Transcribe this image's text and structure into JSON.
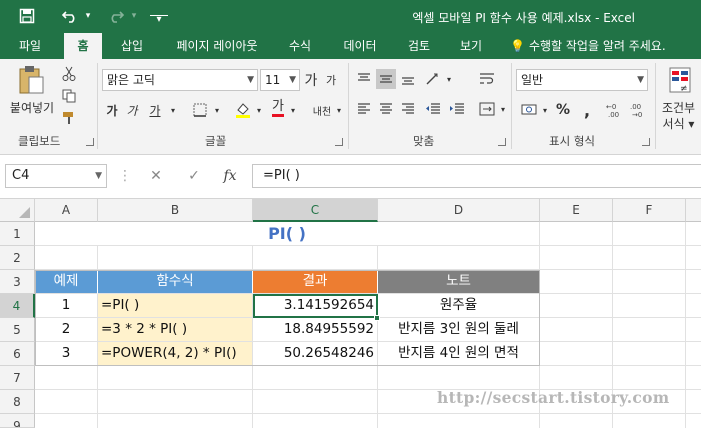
{
  "window": {
    "title": "엑셀 모바일 PI 함수 사용 예제.xlsx - Excel"
  },
  "quick_access": {
    "icons": [
      "save-icon",
      "undo-icon",
      "redo-icon",
      "customize-icon"
    ],
    "undo_dd": "▾",
    "redo_dd": "▾",
    "customize": "▾"
  },
  "tabs": [
    "파일",
    "홈",
    "삽입",
    "페이지 레이아웃",
    "수식",
    "데이터",
    "검토",
    "보기"
  ],
  "active_tab": "홈",
  "tell_me": "수행할 작업을 알려 주세요.",
  "ribbon": {
    "clipboard": {
      "paste_label": "붙여넣기",
      "group_label": "클립보드"
    },
    "font": {
      "name": "맑은 고딕",
      "size": "11",
      "grow_label": "가",
      "shrink_label": "가",
      "bold": "가",
      "italic": "가",
      "underline": "가",
      "font_color_label": "가",
      "phonetic_label": "내천",
      "group_label": "글꼴"
    },
    "alignment": {
      "group_label": "맞춤"
    },
    "number": {
      "format": "일반",
      "percent": "%",
      "comma": ",",
      "group_label": "표시 형식"
    },
    "styles": {
      "label_line1": "조건부",
      "label_line2": "서식 ▾"
    }
  },
  "formula_bar": {
    "name_box": "C4",
    "cancel": "✕",
    "enter": "✓",
    "fx": "fx",
    "formula": "=PI( )"
  },
  "colors": {
    "brand": "#217346",
    "header_blue": "#5b9bd5",
    "header_orange": "#ed7d31",
    "header_gray": "#808080",
    "input_yellow": "#fff2cc",
    "title_blue": "#4472c4"
  },
  "grid": {
    "columns": [
      "A",
      "B",
      "C",
      "D",
      "E",
      "F"
    ],
    "rows": [
      "1",
      "2",
      "3",
      "4",
      "5",
      "6",
      "7",
      "8",
      "9"
    ],
    "title": "PI( )",
    "headers": [
      "예제",
      "함수식",
      "결과",
      "노트"
    ],
    "data": [
      [
        "1",
        "=PI( )",
        "3.141592654",
        "원주율"
      ],
      [
        "2",
        "=3 * 2 * PI( )",
        "18.84955592",
        "반지름 3인 원의 둘레"
      ],
      [
        "3",
        "=POWER(4, 2) * PI()",
        "50.26548246",
        "반지름 4인 원의 면적"
      ]
    ]
  },
  "watermark": "http://secstart.tistory.com"
}
